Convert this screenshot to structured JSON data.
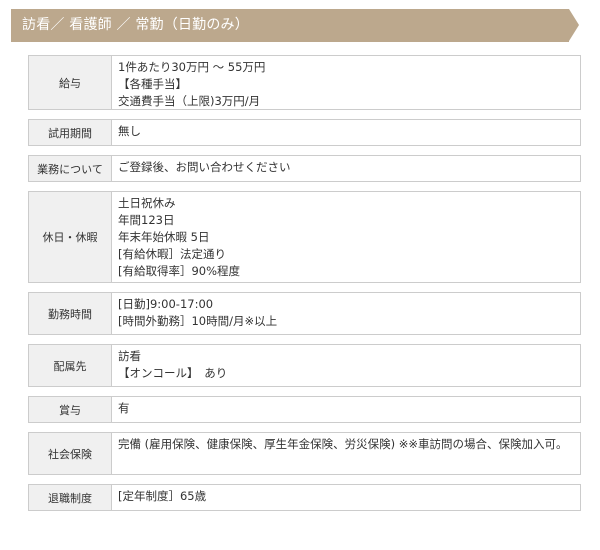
{
  "header": {
    "title": "訪看／ 看護師 ／ 常勤（日勤のみ）"
  },
  "rows": [
    {
      "label": "給与",
      "lines": [
        "1件あたり30万円 〜 55万円",
        "【各種手当】",
        "交通費手当（上限)3万円/月"
      ]
    },
    {
      "label": "試用期間",
      "lines": [
        "無し"
      ]
    },
    {
      "label": "業務について",
      "lines": [
        "ご登録後、お問い合わせください"
      ]
    },
    {
      "label": "休日・休暇",
      "lines": [
        "土日祝休み",
        "年間123日",
        "年末年始休暇 5日",
        "[有給休暇］法定通り",
        "[有給取得率］90%程度"
      ]
    },
    {
      "label": "勤務時間",
      "lines": [
        "[日勤]9:00-17:00",
        "[時間外勤務］10時間/月※以上"
      ]
    },
    {
      "label": "配属先",
      "lines": [
        "訪看",
        "【オンコール】　あり"
      ]
    },
    {
      "label": "賞与",
      "lines": [
        "有"
      ]
    },
    {
      "label": "社会保険",
      "lines": [
        "完備 (雇用保険、健康保険、厚生年金保険、労災保険) ※※車訪問の場合、保険加入可。"
      ]
    },
    {
      "label": "退職制度",
      "lines": [
        "[定年制度］65歳"
      ]
    }
  ],
  "colors": {
    "header_bg": "#bca88d",
    "label_bg": "#f0f0f0",
    "border": "#cccccc"
  }
}
